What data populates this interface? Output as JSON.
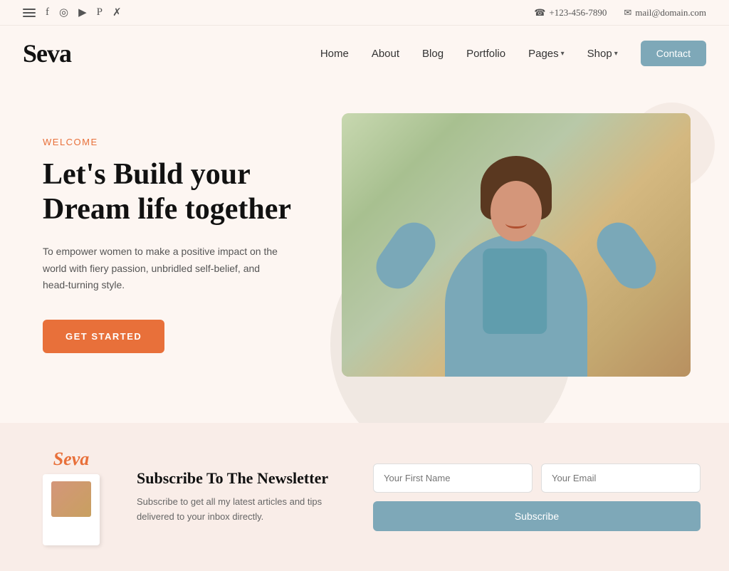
{
  "topbar": {
    "phone": "+123-456-7890",
    "email": "mail@domain.com",
    "phone_icon": "☎",
    "email_icon": "✉"
  },
  "header": {
    "logo": "Seva",
    "nav": {
      "home": "Home",
      "about": "About",
      "blog": "Blog",
      "portfolio": "Portfolio",
      "pages": "Pages",
      "shop": "Shop",
      "contact": "Contact"
    }
  },
  "hero": {
    "welcome_label": "Welcome",
    "title_line1": "Let's Build your",
    "title_line2": "Dream life together",
    "description": "To empower women to make a positive impact on the world with fiery passion, unbridled self-belief, and head-turning style.",
    "cta_label": "GET STARTED"
  },
  "newsletter": {
    "logo": "Seva",
    "title": "Subscribe To The Newsletter",
    "description": "Subscribe to get all my latest articles and tips delivered to your inbox directly.",
    "first_name_placeholder": "Your First Name",
    "email_placeholder": "Your Email",
    "submit_label": "Subscribe"
  },
  "social_icons": {
    "hamburger": "☰",
    "facebook": "f",
    "instagram": "◎",
    "youtube": "▶",
    "pinterest": "P",
    "twitter": "✗"
  }
}
